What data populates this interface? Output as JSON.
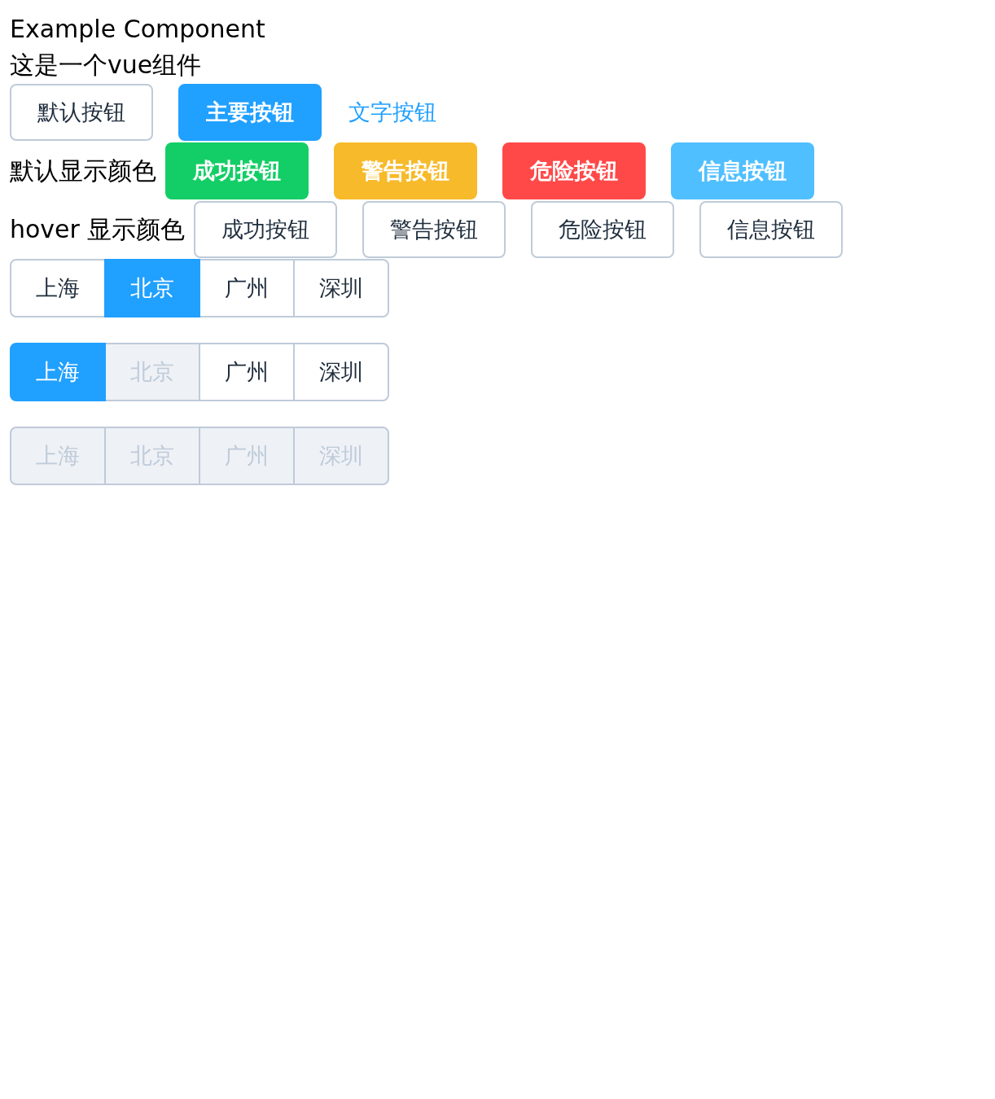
{
  "header": {
    "title": "Example Component",
    "subtitle": "这是一个vue组件"
  },
  "basic_buttons": [
    {
      "label": "默认按钮",
      "kind": "default"
    },
    {
      "label": "主要按钮",
      "kind": "primary"
    },
    {
      "label": "文字按钮",
      "kind": "text"
    }
  ],
  "color_rows": [
    {
      "label": "默认显示颜色",
      "kind": "filled",
      "buttons": [
        {
          "label": "成功按钮",
          "color": "#13ce66"
        },
        {
          "label": "警告按钮",
          "color": "#f7ba2a"
        },
        {
          "label": "危险按钮",
          "color": "#ff4949"
        },
        {
          "label": "信息按钮",
          "color": "#50bfff"
        }
      ]
    },
    {
      "label": "hover 显示颜色",
      "kind": "outline",
      "buttons": [
        {
          "label": "成功按钮"
        },
        {
          "label": "警告按钮"
        },
        {
          "label": "危险按钮"
        },
        {
          "label": "信息按钮"
        }
      ]
    }
  ],
  "radio_groups": [
    {
      "options": [
        {
          "label": "上海",
          "selected": false,
          "disabled": false
        },
        {
          "label": "北京",
          "selected": true,
          "disabled": false
        },
        {
          "label": "广州",
          "selected": false,
          "disabled": false
        },
        {
          "label": "深圳",
          "selected": false,
          "disabled": false
        }
      ]
    },
    {
      "options": [
        {
          "label": "上海",
          "selected": true,
          "disabled": false
        },
        {
          "label": "北京",
          "selected": false,
          "disabled": true
        },
        {
          "label": "广州",
          "selected": false,
          "disabled": false
        },
        {
          "label": "深圳",
          "selected": false,
          "disabled": false
        }
      ]
    },
    {
      "options": [
        {
          "label": "上海",
          "selected": false,
          "disabled": true
        },
        {
          "label": "北京",
          "selected": false,
          "disabled": true
        },
        {
          "label": "广州",
          "selected": false,
          "disabled": true
        },
        {
          "label": "深圳",
          "selected": false,
          "disabled": true
        }
      ]
    }
  ]
}
